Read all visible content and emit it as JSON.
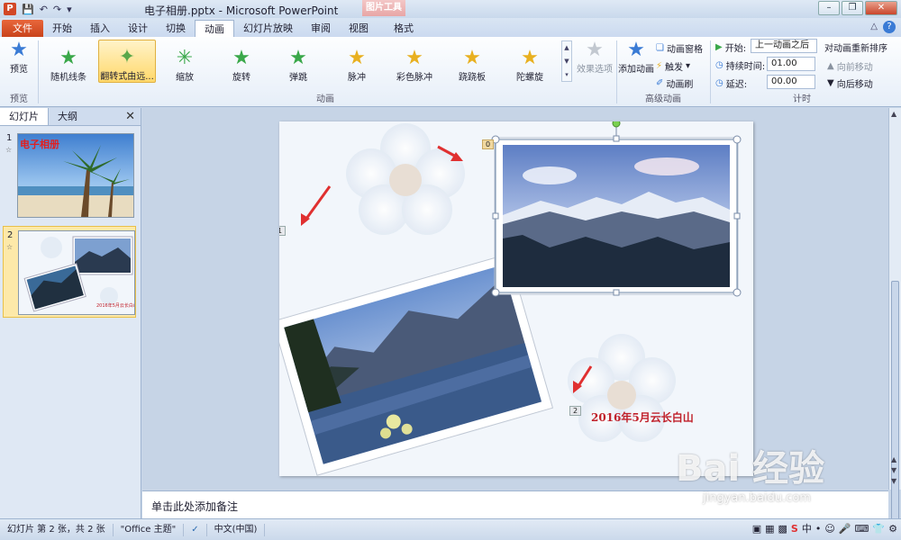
{
  "titlebar": {
    "app_icon": "P",
    "title": "电子相册.pptx - Microsoft PowerPoint",
    "context_group": "图片工具",
    "qat_icons": [
      "save-icon",
      "undo-icon",
      "redo-icon"
    ]
  },
  "tabs": [
    {
      "label": "文件"
    },
    {
      "label": "开始"
    },
    {
      "label": "插入"
    },
    {
      "label": "设计"
    },
    {
      "label": "切换"
    },
    {
      "label": "动画"
    },
    {
      "label": "幻灯片放映"
    },
    {
      "label": "审阅"
    },
    {
      "label": "视图"
    },
    {
      "label": "格式"
    }
  ],
  "ribbon": {
    "preview": {
      "label": "预览",
      "group": "预览"
    },
    "animations": [
      {
        "label": "随机线条"
      },
      {
        "label": "翻转式由远..."
      },
      {
        "label": "缩放"
      },
      {
        "label": "旋转"
      },
      {
        "label": "弹跳"
      },
      {
        "label": "脉冲"
      },
      {
        "label": "彩色脉冲"
      },
      {
        "label": "跷跷板"
      },
      {
        "label": "陀螺旋"
      }
    ],
    "effect_options": "效果选项",
    "animation_group": "动画",
    "add_animation": "添加动画",
    "animation_pane": "动画窗格",
    "trigger": "触发",
    "painter": "动画刷",
    "advanced_group": "高级动画",
    "start_label": "开始:",
    "start_value": "上一动画之后",
    "duration_label": "持续时间:",
    "duration_value": "01.00",
    "delay_label": "延迟:",
    "delay_value": "00.00",
    "timing_group": "计时",
    "reorder_title": "对动画重新排序",
    "move_earlier": "向前移动",
    "move_later": "向后移动"
  },
  "left_pane": {
    "tab_slides": "幻灯片",
    "tab_outline": "大纲",
    "slide1_num": "1",
    "slide2_num": "2",
    "slide1_title": "电子相册"
  },
  "slide": {
    "tag0": "0",
    "tag1": "1",
    "tag2": "2",
    "caption": "2016年5月云长白山"
  },
  "notes": {
    "placeholder": "单击此处添加备注"
  },
  "status": {
    "slide_info": "幻灯片 第 2 张，共 2 张",
    "theme": "\"Office 主题\"",
    "language": "中文(中国)"
  },
  "watermark": {
    "logo": "Bai 经验",
    "url": "jingyan.baidu.com"
  },
  "colors": {
    "accent": "#c9431b",
    "caption": "#c0202a",
    "arrow": "#e03030"
  }
}
